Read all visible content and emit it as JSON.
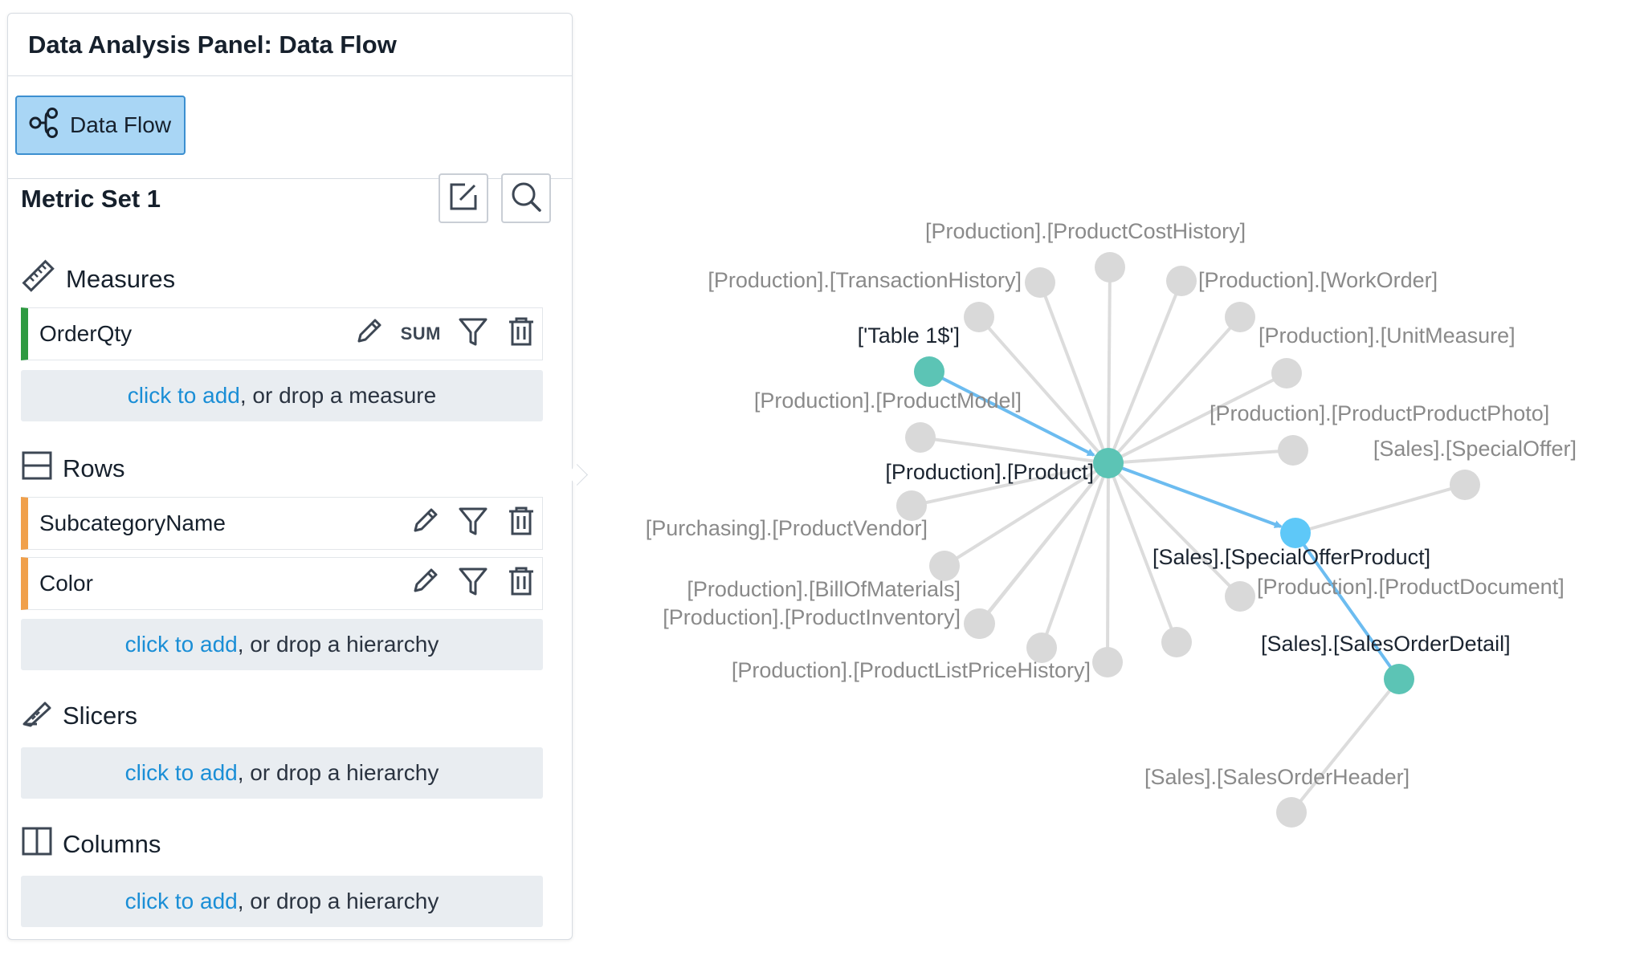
{
  "panel": {
    "title": "Data Analysis Panel: Data Flow",
    "dataflow_button": "Data Flow",
    "metric_set": {
      "title": "Metric Set 1",
      "edit_icon": "edit-icon",
      "search_icon": "search-icon"
    },
    "measures": {
      "label": "Measures",
      "items": [
        {
          "name": "OrderQty",
          "aggregation": "SUM"
        }
      ],
      "drop_link": "click to add",
      "drop_text": ", or drop a measure"
    },
    "rows": {
      "label": "Rows",
      "items": [
        {
          "name": "SubcategoryName"
        },
        {
          "name": "Color"
        }
      ],
      "drop_link": "click to add",
      "drop_text": ", or drop a hierarchy"
    },
    "slicers": {
      "label": "Slicers",
      "drop_link": "click to add",
      "drop_text": ", or drop a hierarchy"
    },
    "columns": {
      "label": "Columns",
      "drop_link": "click to add",
      "drop_text": ", or drop a hierarchy"
    }
  },
  "graph": {
    "colors": {
      "node_gray": "#d9d9d9",
      "node_teal": "#5cc4b5",
      "node_blue": "#5ec8f8",
      "edge_gray": "#dcdcdc",
      "edge_blue": "#6cbcf0",
      "label_gray": "#8a8a8a",
      "label_dark": "#1b2430"
    },
    "labels": {
      "product": "[Production].[Product]",
      "table1": "['Table 1$']",
      "special_offer_product": "[Sales].[SpecialOfferProduct]",
      "sales_order_detail": "[Sales].[SalesOrderDetail]",
      "product_cost_history": "[Production].[ProductCostHistory]",
      "transaction_history": "[Production].[TransactionHistory]",
      "work_order": "[Production].[WorkOrder]",
      "unit_measure": "[Production].[UnitMeasure]",
      "product_model": "[Production].[ProductModel]",
      "product_product_photo": "[Production].[ProductProductPhoto]",
      "special_offer": "[Sales].[SpecialOffer]",
      "product_vendor": "[Purchasing].[ProductVendor]",
      "product_document": "[Production].[ProductDocument]",
      "bill_of_materials": "[Production].[BillOfMaterials]",
      "product_inventory": "[Production].[ProductInventory]",
      "product_list_price_history": "[Production].[ProductListPriceHistory]",
      "sales_order_header": "[Sales].[SalesOrderHeader]"
    }
  }
}
